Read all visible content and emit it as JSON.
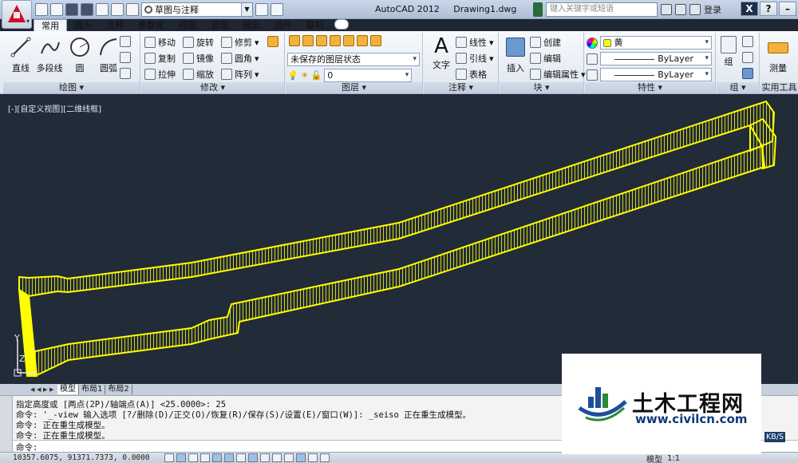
{
  "title_bar": {
    "workspace": "草图与注释",
    "app_name": "AutoCAD 2012",
    "file_name": "Drawing1.dwg",
    "search_placeholder": "键入关键字或短语",
    "login_label": "登录"
  },
  "tabs": [
    "常用",
    "插入",
    "注释",
    "参数化",
    "视图",
    "管理",
    "输出",
    "插件",
    "联机"
  ],
  "ribbon": {
    "draw": {
      "title": "绘图",
      "line": "直线",
      "polyline": "多段线",
      "circle": "圆",
      "arc": "圆弧"
    },
    "modify": {
      "title": "修改",
      "move": "移动",
      "rotate": "旋转",
      "trim": "修剪",
      "copy": "复制",
      "mirror": "镜像",
      "fillet": "圆角",
      "stretch": "拉伸",
      "scale": "缩放",
      "array": "阵列"
    },
    "layers": {
      "title": "图层",
      "layer_state": "未保存的图层状态",
      "current_layer": "0"
    },
    "annotation": {
      "title": "注释",
      "text": "文字",
      "linear": "线性",
      "leader": "引线",
      "table": "表格"
    },
    "block": {
      "title": "块",
      "insert": "插入",
      "create": "创建",
      "edit": "编辑",
      "edit_attributes": "编辑属性"
    },
    "properties": {
      "title": "特性",
      "color": "黄",
      "color_hex": "#ffff00",
      "linetype": "ByLayer",
      "lineweight": "ByLayer"
    },
    "groups": {
      "title": "组",
      "group": "组"
    },
    "utilities": {
      "title": "实用工具",
      "measure": "测量"
    }
  },
  "viewport": {
    "label": "[-][自定义视图][二维线框]",
    "ucs_y": "Y",
    "ucs_z": "Z"
  },
  "layout_tabs": [
    "模型",
    "布局1",
    "布局2"
  ],
  "command": {
    "history": [
      "指定高度或 [两点(2P)/轴端点(A)] <25.0000>: 25",
      "命令: '_-view 输入选项 [?/删除(D)/正交(O)/恢复(R)/保存(S)/设置(E)/窗口(W)]: _seiso 正在重生成模型。",
      "命令:  正在重生成模型。",
      "命令:  正在重生成模型。"
    ],
    "prompt": "命令:"
  },
  "status": {
    "coords": "10357.6075, 91371.7373, 0.0000",
    "model_label": "模型",
    "scale": "1:1",
    "network_speed": "KB/S"
  },
  "watermark": {
    "name": "土木工程网",
    "url": "www.civilcn.com"
  },
  "colors": {
    "drawing_stroke": "#ffff00",
    "viewport_bg": "#222b38",
    "ribbon_bg": "#e8edf4"
  }
}
